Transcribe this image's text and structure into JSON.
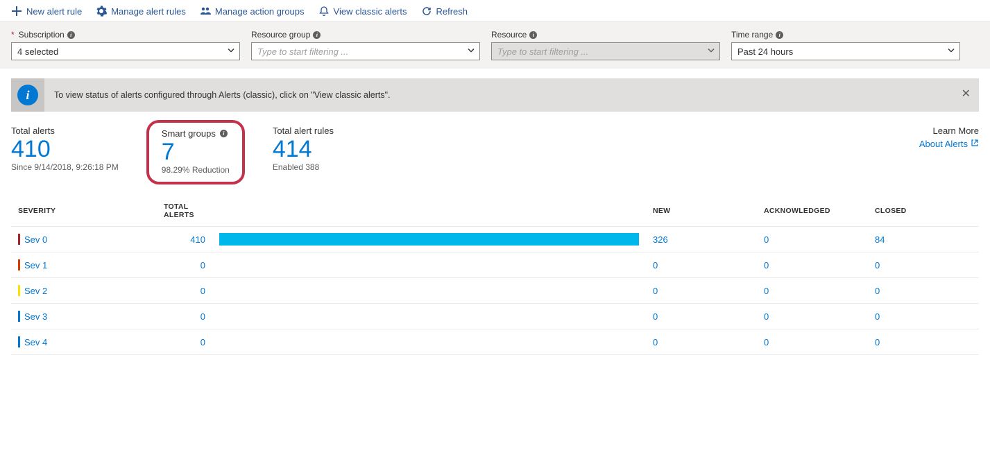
{
  "toolbar": {
    "new_rule": "New alert rule",
    "manage_rules": "Manage alert rules",
    "manage_action_groups": "Manage action groups",
    "view_classic": "View classic alerts",
    "refresh": "Refresh"
  },
  "filters": {
    "subscription": {
      "label": "Subscription",
      "value": "4 selected",
      "required": true
    },
    "resource_group": {
      "label": "Resource group",
      "placeholder": "Type to start filtering ..."
    },
    "resource": {
      "label": "Resource",
      "placeholder": "Type to start filtering ..."
    },
    "time_range": {
      "label": "Time range",
      "value": "Past 24 hours"
    }
  },
  "banner": {
    "text": "To view status of alerts configured through Alerts (classic), click on \"View classic alerts\"."
  },
  "summary": {
    "total_alerts": {
      "title": "Total alerts",
      "value": "410",
      "sub": "Since 9/14/2018, 9:26:18 PM"
    },
    "smart_groups": {
      "title": "Smart groups",
      "value": "7",
      "sub": "98.29% Reduction"
    },
    "total_rules": {
      "title": "Total alert rules",
      "value": "414",
      "sub": "Enabled 388"
    }
  },
  "links": {
    "learn_more": "Learn More",
    "about_alerts": "About Alerts"
  },
  "table": {
    "headers": {
      "severity": "Severity",
      "total": "Total Alerts",
      "new": "New",
      "ack": "Acknowledged",
      "closed": "Closed"
    },
    "rows": [
      {
        "sev": "Sev 0",
        "color": "#a4262c",
        "total": "410",
        "bar_pct": 100,
        "new": "326",
        "ack": "0",
        "closed": "84"
      },
      {
        "sev": "Sev 1",
        "color": "#d83b01",
        "total": "0",
        "bar_pct": 0,
        "new": "0",
        "ack": "0",
        "closed": "0"
      },
      {
        "sev": "Sev 2",
        "color": "#fce100",
        "total": "0",
        "bar_pct": 0,
        "new": "0",
        "ack": "0",
        "closed": "0"
      },
      {
        "sev": "Sev 3",
        "color": "#0078d4",
        "total": "0",
        "bar_pct": 0,
        "new": "0",
        "ack": "0",
        "closed": "0"
      },
      {
        "sev": "Sev 4",
        "color": "#0078d4",
        "total": "0",
        "bar_pct": 0,
        "new": "0",
        "ack": "0",
        "closed": "0"
      }
    ]
  }
}
